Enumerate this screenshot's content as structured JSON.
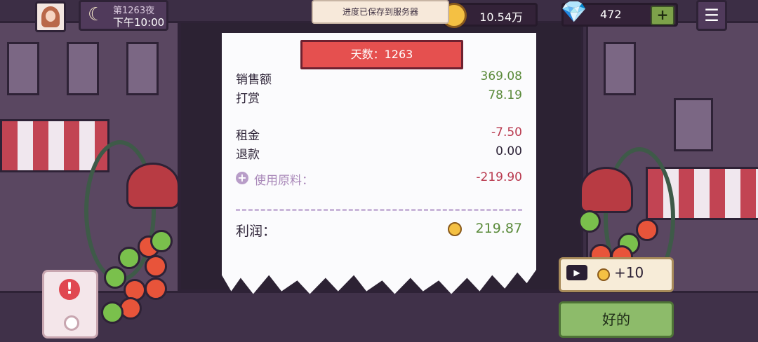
{
  "header": {
    "night_label": "第1263夜",
    "time_label": "下午10:00",
    "toast": "进度已保存到服务器",
    "coins": "10.54万",
    "gems": "472",
    "add_gem": "+",
    "menu_icon": "☰",
    "moon_icon": "☾",
    "gem_icon": "💎"
  },
  "receipt": {
    "day_title": "天数：1263",
    "sales": {
      "label": "销售额",
      "value": "369.08"
    },
    "tips": {
      "label": "打赏",
      "value": "78.19"
    },
    "rent": {
      "label": "租金",
      "value": "-7.50"
    },
    "refund": {
      "label": "退款",
      "value": "0.00"
    },
    "ingredients": {
      "label": "使用原料：",
      "value": "-219.90",
      "expand_icon": "+"
    },
    "profit": {
      "label": "利润：",
      "value": "219.87"
    }
  },
  "actions": {
    "ad_bonus_label": "+10",
    "video_icon": "▶",
    "ok_label": "好的"
  },
  "alert": {
    "icon": "!"
  },
  "colors": {
    "positive": "#5a8a3a",
    "negative": "#b93a4f",
    "ribbon": "#e5504f",
    "ok_button": "#8dbb6a"
  }
}
